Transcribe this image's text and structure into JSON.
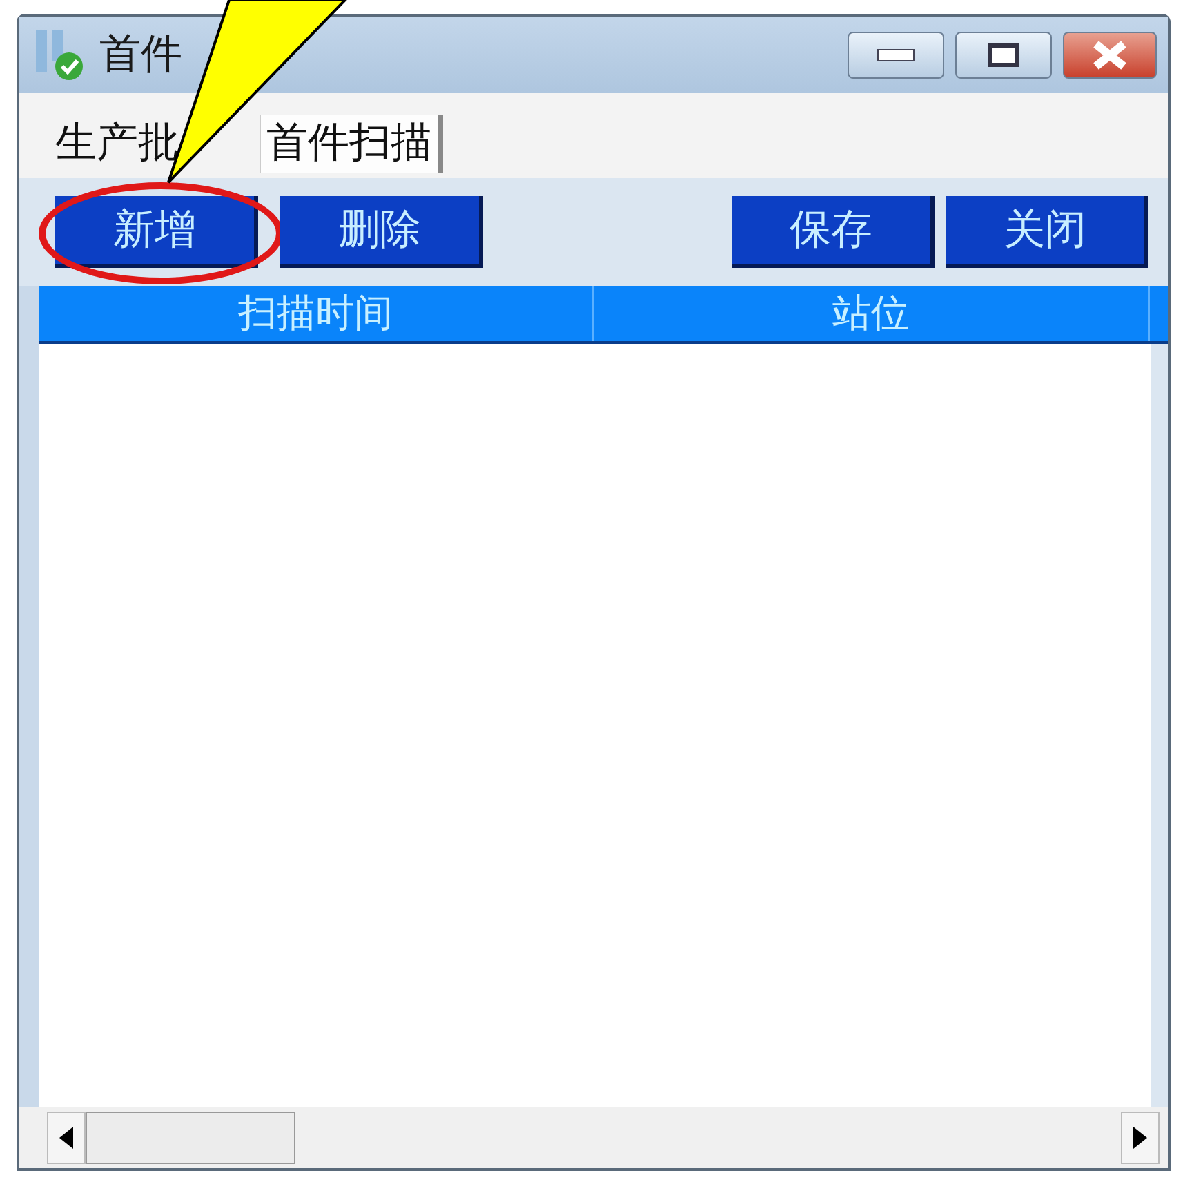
{
  "window": {
    "title": "首件"
  },
  "tabs": [
    {
      "label": "生产批",
      "selected": false
    },
    {
      "label": "首件扫描",
      "selected": true
    }
  ],
  "toolbar": {
    "left_buttons": [
      {
        "label": "新增",
        "circled": true
      },
      {
        "label": "删除",
        "circled": false
      }
    ],
    "right_buttons": [
      {
        "label": "保存",
        "circled": false
      },
      {
        "label": "关闭",
        "circled": false
      }
    ]
  },
  "table": {
    "columns": [
      "扫描时间",
      "站位"
    ]
  }
}
